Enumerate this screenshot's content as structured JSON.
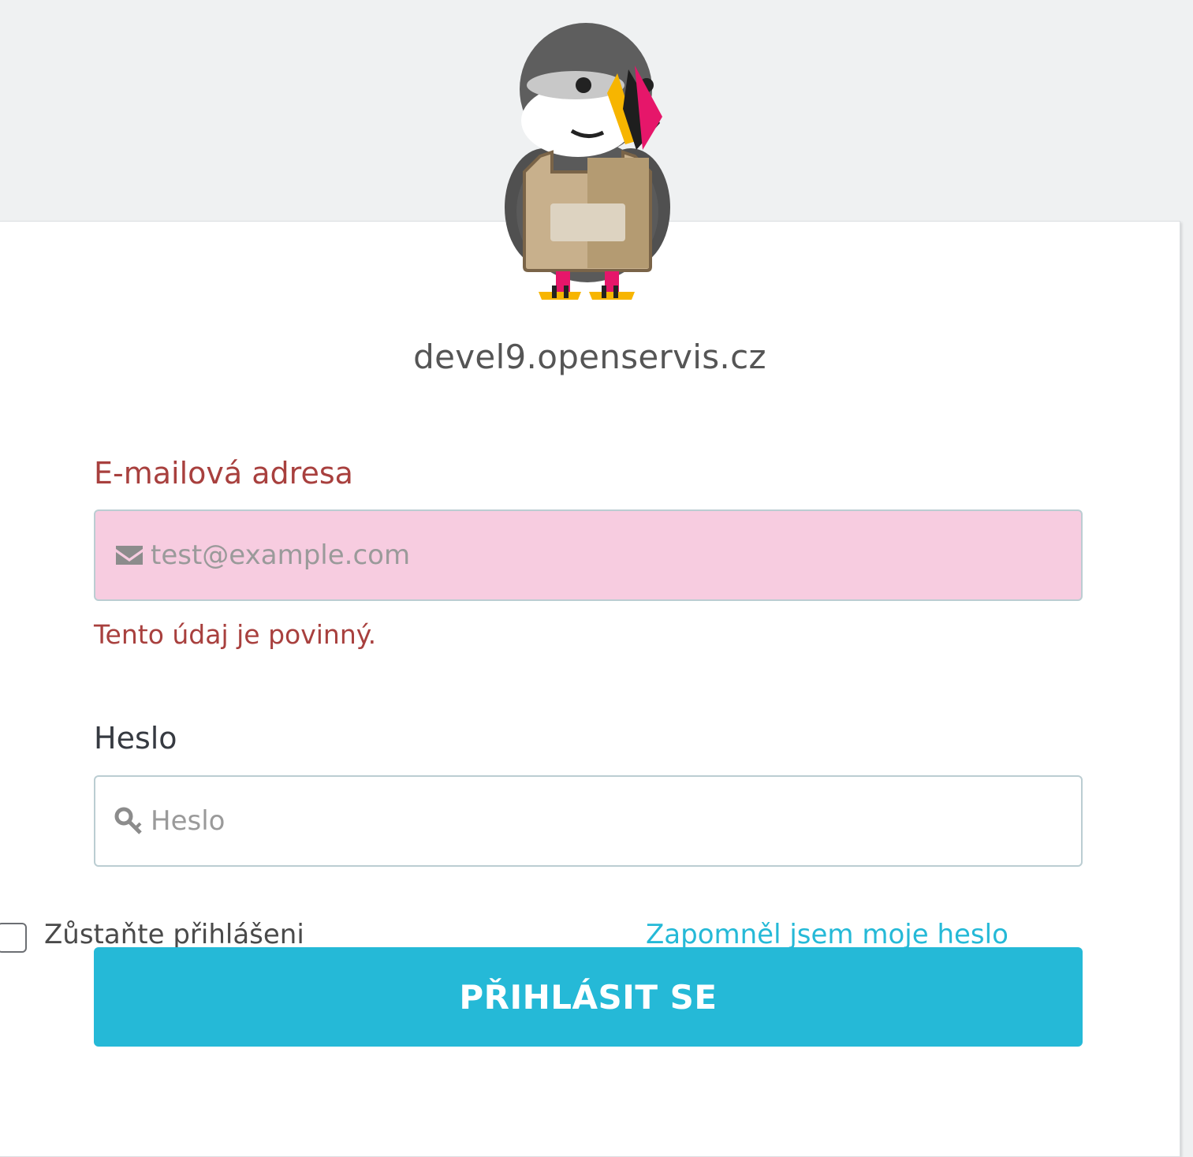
{
  "shop": {
    "name": "devel9.openservis.cz",
    "logo_icon": "puffin-mascot-logo"
  },
  "email": {
    "label": "E-mailová adresa",
    "placeholder": "test@example.com",
    "value": "",
    "icon": "envelope-icon",
    "error": "Tento údaj je povinný.",
    "state": "error"
  },
  "password": {
    "label": "Heslo",
    "placeholder": "Heslo",
    "value": "",
    "icon": "key-icon"
  },
  "remember_me": {
    "label": "Zůstaňte přihlášeni",
    "checked": false
  },
  "forgot_password": {
    "label": "Zapomněl jsem moje heslo"
  },
  "submit": {
    "label": "PŘIHLÁSIT SE"
  },
  "colors": {
    "accent": "#25b9d7",
    "error": "#a8403e",
    "error_background": "#f7cce0",
    "page_background": "#eff1f2"
  }
}
